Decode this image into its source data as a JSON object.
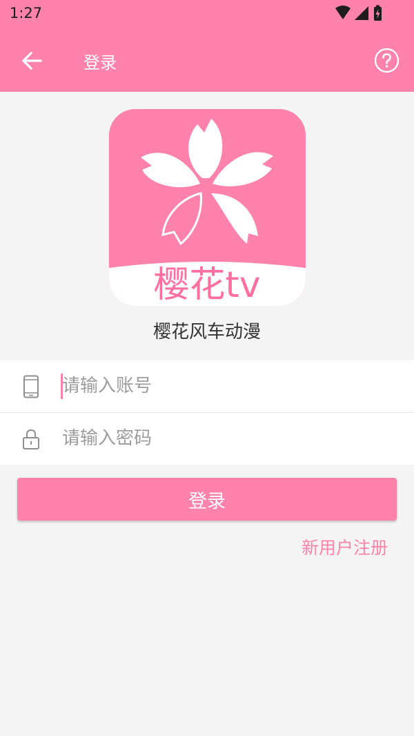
{
  "status_bar": {
    "time": "1:27",
    "icons": [
      "wifi-icon",
      "signal-icon",
      "battery-charging-icon"
    ]
  },
  "app_bar": {
    "title": "登录",
    "back_icon": "arrow-left-icon",
    "help_icon": "help-circle-icon",
    "background": "#ff82ad"
  },
  "logo": {
    "text": "樱花tv",
    "icon": "sakura-flower-icon"
  },
  "app_name": "樱花风车动漫",
  "form": {
    "account": {
      "placeholder": "请输入账号",
      "value": "",
      "icon": "phone-icon"
    },
    "password": {
      "placeholder": "请输入密码",
      "value": "",
      "icon": "lock-icon"
    }
  },
  "login_button_label": "登录",
  "register_link_label": "新用户注册",
  "colors": {
    "accent": "#ff82ad",
    "background": "#f4f4f4",
    "placeholder": "#9c9c9c",
    "text": "#333333"
  }
}
